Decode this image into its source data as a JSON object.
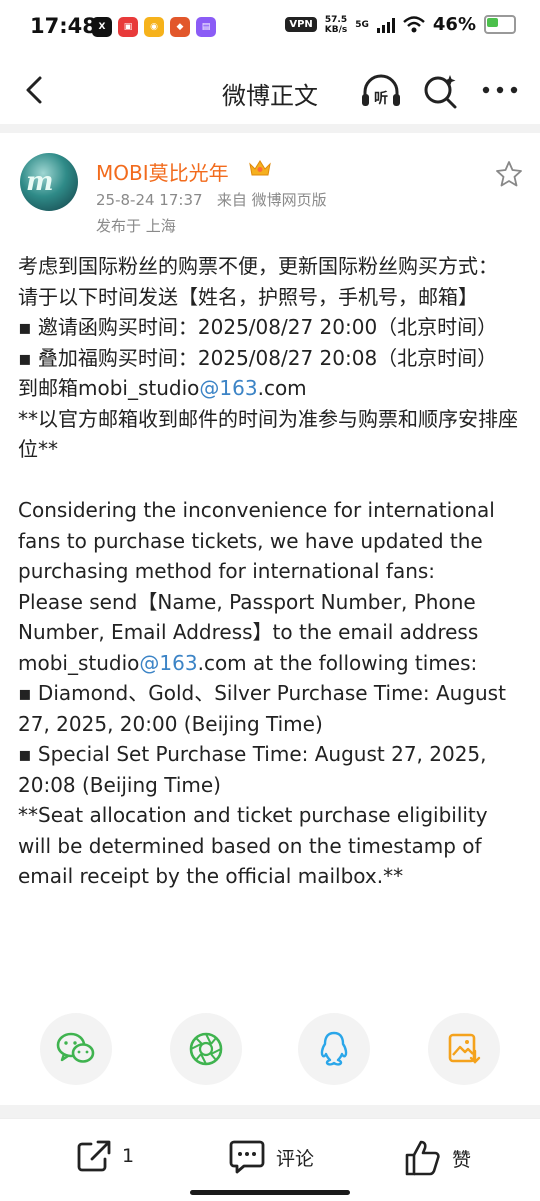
{
  "status_bar": {
    "time": "17:48",
    "app_icons": [
      "x-icon",
      "app-icon-1",
      "weibo-icon",
      "app-icon-2",
      "app-icon-3"
    ],
    "vpn": "VPN",
    "net_speed": "57.5",
    "net_unit": "KB/s",
    "network": "5G",
    "battery": "46%"
  },
  "nav": {
    "title": "微博正文",
    "listen_label": "听"
  },
  "post": {
    "author": "MOBI莫比光年",
    "avatar_text": "m",
    "time": "25-8-24 17:37",
    "source": "来自 微博网页版",
    "location": "发布于 上海",
    "cn": {
      "l1": "考虑到国际粉丝的购票不便，更新国际粉丝购买方式：",
      "l2": "请于以下时间发送【姓名，护照号，手机号，邮箱】",
      "l3": "▪ 邀请函购买时间：2025/08/27 20:00（北京时间）",
      "l4": "▪ 叠加福购买时间：2025/08/27 20:08（北京时间）",
      "l5_pre": "到邮箱mobi_studio",
      "l5_link": "@163",
      "l5_post": ".com",
      "l6": "**以官方邮箱收到邮件的时间为准参与购票和顺序安排座位**"
    },
    "en": {
      "p1": "Considering the inconvenience for international fans to purchase tickets, we have updated the purchasing method for international fans:",
      "p2_pre": "Please send【Name, Passport Number, Phone Number, Email Address】to the email address mobi_studio",
      "p2_link": "@163",
      "p2_post": ".com at the following times:",
      "p3": "▪ Diamond、Gold、Silver Purchase Time: August 27, 2025, 20:00 (Beijing Time)",
      "p4": "▪  Special Set Purchase Time: August 27, 2025, 20:08 (Beijing Time)",
      "p5": "**Seat allocation and ticket purchase eligibility will be determined based on the timestamp of email receipt by the official mailbox.**"
    }
  },
  "bottom": {
    "repost_count": "1",
    "comment_label": "评论",
    "like_label": "赞"
  },
  "colors": {
    "username": "#f26b1d",
    "link": "#3c84c6",
    "wechat": "#3fb34f",
    "qq": "#2aa6e9",
    "image": "#f4a21c"
  }
}
